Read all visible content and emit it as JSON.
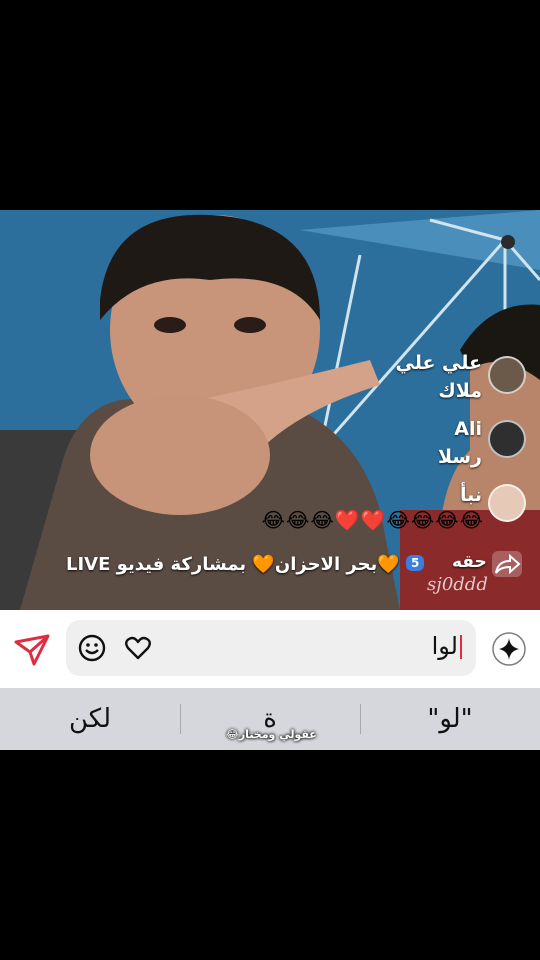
{
  "comments": [
    {
      "name": "علي علي",
      "text": "ملاك"
    },
    {
      "name": "Ali",
      "text": "رسلا"
    },
    {
      "name": "نبأ",
      "text": ""
    }
  ],
  "emoji_row": "😂😂😂❤️❤️😂😂😂😂",
  "share": {
    "text": "🧡بحر الاحزان🧡 بمشاركة فيديو LIVE",
    "badge": "5",
    "user": "حقه"
  },
  "watermark": "sj0ddd",
  "input": {
    "value": "لوا"
  },
  "suggestions": [
    "لكن",
    "ة",
    "\"لو\""
  ],
  "caption": "عقولي ومختار😂",
  "colors": {
    "send": "#e02c41",
    "cursor": "#e02c41",
    "sparkle_ring": "#7d7d7d"
  }
}
